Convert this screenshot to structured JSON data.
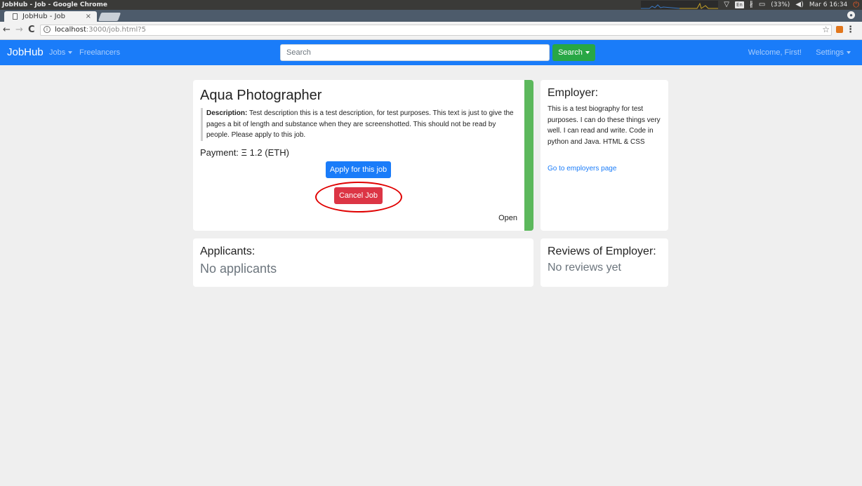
{
  "os": {
    "window_title": "JobHub - Job - Google Chrome",
    "keyboard_layout": "En",
    "battery": "(33%)",
    "datetime": "Mar 6 16:34"
  },
  "browser": {
    "tab_title": "JobHub - Job",
    "tab_close": "×",
    "url_host": "localhost",
    "url_path": ":3000/job.html?5"
  },
  "navbar": {
    "brand": "JobHub",
    "jobs_label": "Jobs",
    "freelancers_label": "Freelancers",
    "search_placeholder": "Search",
    "search_button": "Search",
    "welcome": "Welcome, First!",
    "settings_label": "Settings"
  },
  "job": {
    "title": "Aqua Photographer",
    "description_label": "Description:",
    "description": "Test description this is a test description, for test purposes. This text is just to give the pages a bit of length and substance when they are screenshotted. This should not be read by people. Please apply to this job.",
    "payment": "Payment: Ξ 1.2 (ETH)",
    "apply_button": "Apply for this job",
    "cancel_button": "Cancel Job",
    "status": "Open",
    "status_bar_color": "#5cb85c"
  },
  "employer": {
    "heading": "Employer:",
    "bio": "This is a test biography for test purposes. I can do these things very well. I can read and write. Code in python and Java. HTML & CSS",
    "link": "Go to employers page"
  },
  "applicants": {
    "heading": "Applicants:",
    "empty": "No applicants"
  },
  "reviews": {
    "heading": "Reviews of Employer:",
    "empty": "No reviews yet"
  },
  "colors": {
    "primary": "#1a7cf9",
    "success": "#28a745",
    "danger": "#dc3545",
    "annotation": "#e00000"
  }
}
